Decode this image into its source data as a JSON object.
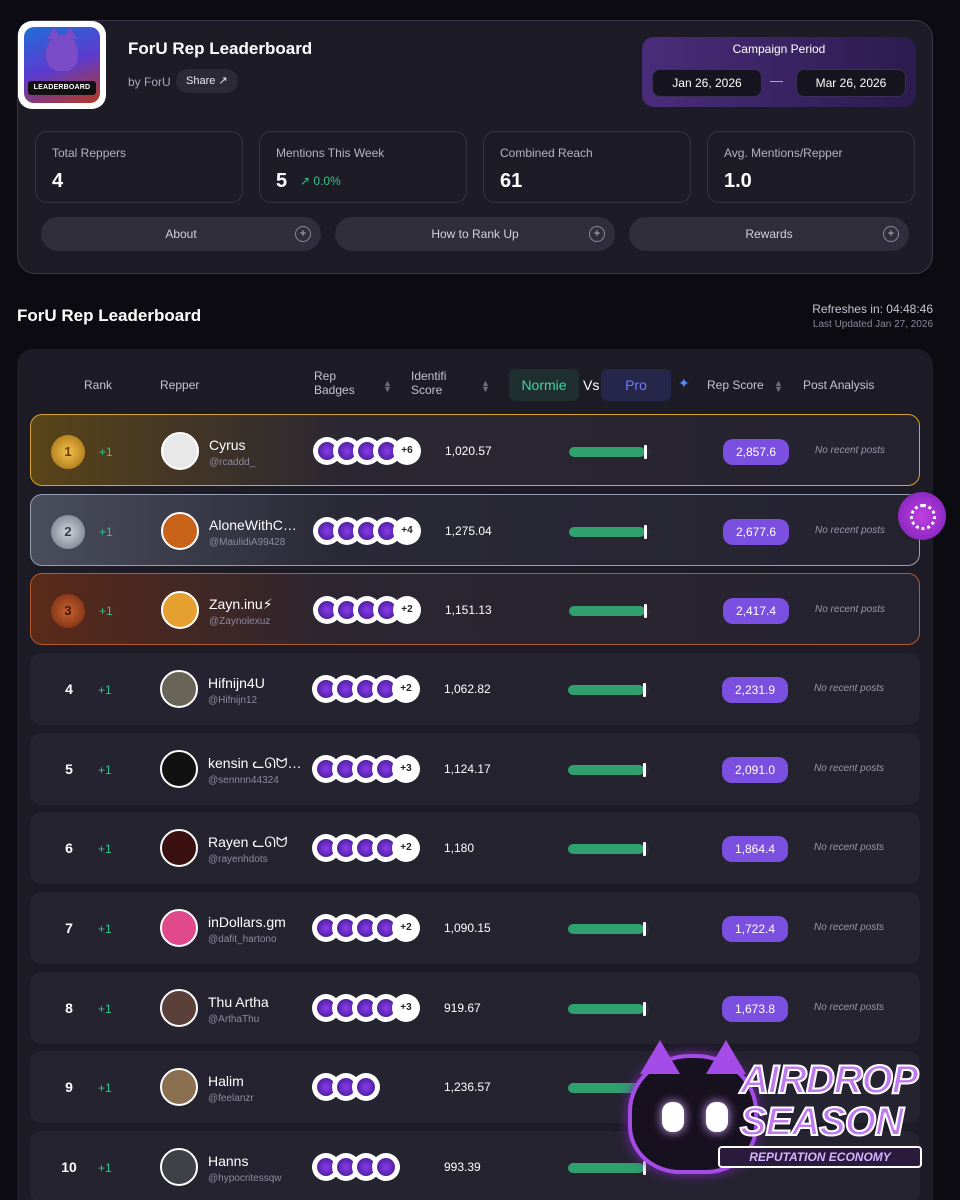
{
  "header": {
    "logo_text": "LEADERBOARD",
    "title": "ForU Rep Leaderboard",
    "by": "by ForU",
    "share_label": "Share ↗"
  },
  "campaign": {
    "label": "Campaign Period",
    "start": "Jan 26, 2026",
    "separator": "—",
    "end": "Mar 26, 2026"
  },
  "stats": [
    {
      "label": "Total Reppers",
      "value": "4"
    },
    {
      "label": "Mentions This Week",
      "value": "5",
      "change": "↗ 0.0%"
    },
    {
      "label": "Combined Reach",
      "value": "61"
    },
    {
      "label": "Avg. Mentions/Repper",
      "value": "1.0"
    }
  ],
  "accordions": [
    "About",
    "How to Rank Up",
    "Rewards"
  ],
  "section_title": "ForU Rep Leaderboard",
  "refresh": {
    "main": "Refreshes in: 04:48:46",
    "sub": "Last Updated Jan 27, 2026"
  },
  "columns": {
    "rank": "Rank",
    "repper": "Repper",
    "rep_badges": "Rep Badges",
    "identity_score": "Identifi Score",
    "normie": "Normie",
    "vs": "Vs",
    "pro": "Pro",
    "rep_score": "Rep Score",
    "post_analysis": "Post Analysis"
  },
  "rows": [
    {
      "rank": "1",
      "change": "+1",
      "name": "Cyrus",
      "handle": "@rcaddd_",
      "badges": 4,
      "more": "+6",
      "identity": "1,020.57",
      "normie_pct": 0.95,
      "rep": "2,857.6",
      "post": "No recent posts",
      "avatar_color": "#e8e8e8"
    },
    {
      "rank": "2",
      "change": "+1",
      "name": "AloneWithC…",
      "handle": "@MaulidiA99428",
      "badges": 4,
      "more": "+4",
      "identity": "1,275.04",
      "normie_pct": 0.95,
      "rep": "2,677.6",
      "post": "No recent posts",
      "avatar_color": "#c9631a"
    },
    {
      "rank": "3",
      "change": "+1",
      "name": "Zayn.inu⚡",
      "handle": "@Zaynolexuz",
      "badges": 4,
      "more": "+2",
      "identity": "1,151.13",
      "normie_pct": 0.95,
      "rep": "2,417.4",
      "post": "No recent posts",
      "avatar_color": "#e6a030"
    },
    {
      "rank": "4",
      "change": "+1",
      "name": "Hifnijn4U",
      "handle": "@Hifnijn12",
      "badges": 4,
      "more": "+2",
      "identity": "1,062.82",
      "normie_pct": 0.95,
      "rep": "2,231.9",
      "post": "No recent posts",
      "avatar_color": "#6a6458"
    },
    {
      "rank": "5",
      "change": "+1",
      "name": "kensin ᓚᘏᗢ…",
      "handle": "@sennnn44324",
      "badges": 4,
      "more": "+3",
      "identity": "1,124.17",
      "normie_pct": 0.95,
      "rep": "2,091.0",
      "post": "No recent posts",
      "avatar_color": "#111111"
    },
    {
      "rank": "6",
      "change": "+1",
      "name": "Rayen ᓚᘏᗢ",
      "handle": "@rayenhdots",
      "badges": 4,
      "more": "+2",
      "identity": "1,180",
      "normie_pct": 0.95,
      "rep": "1,864.4",
      "post": "No recent posts",
      "avatar_color": "#3a1010"
    },
    {
      "rank": "7",
      "change": "+1",
      "name": "inDollars.gm",
      "handle": "@dafit_hartono",
      "badges": 4,
      "more": "+2",
      "identity": "1,090.15",
      "normie_pct": 0.95,
      "rep": "1,722.4",
      "post": "No recent posts",
      "avatar_color": "#e04a8a"
    },
    {
      "rank": "8",
      "change": "+1",
      "name": "Thu Artha",
      "handle": "@ArthaThu",
      "badges": 4,
      "more": "+3",
      "identity": "919.67",
      "normie_pct": 0.95,
      "rep": "1,673.8",
      "post": "No recent posts",
      "avatar_color": "#5a4038"
    },
    {
      "rank": "9",
      "change": "+1",
      "name": "Halim",
      "handle": "@feelanzr",
      "badges": 3,
      "more": "",
      "identity": "1,236.57",
      "normie_pct": 0.95,
      "rep": "",
      "post": "",
      "avatar_color": "#8a7050"
    },
    {
      "rank": "10",
      "change": "+1",
      "name": "Hanns",
      "handle": "@hypocritessqw",
      "badges": 4,
      "more": "",
      "identity": "993.39",
      "normie_pct": 0.95,
      "rep": "",
      "post": "",
      "avatar_color": "#404048"
    }
  ],
  "sticker": {
    "line1": "AIRDROP",
    "line2": "SEASON",
    "tag": "REPUTATION ECONOMY"
  }
}
